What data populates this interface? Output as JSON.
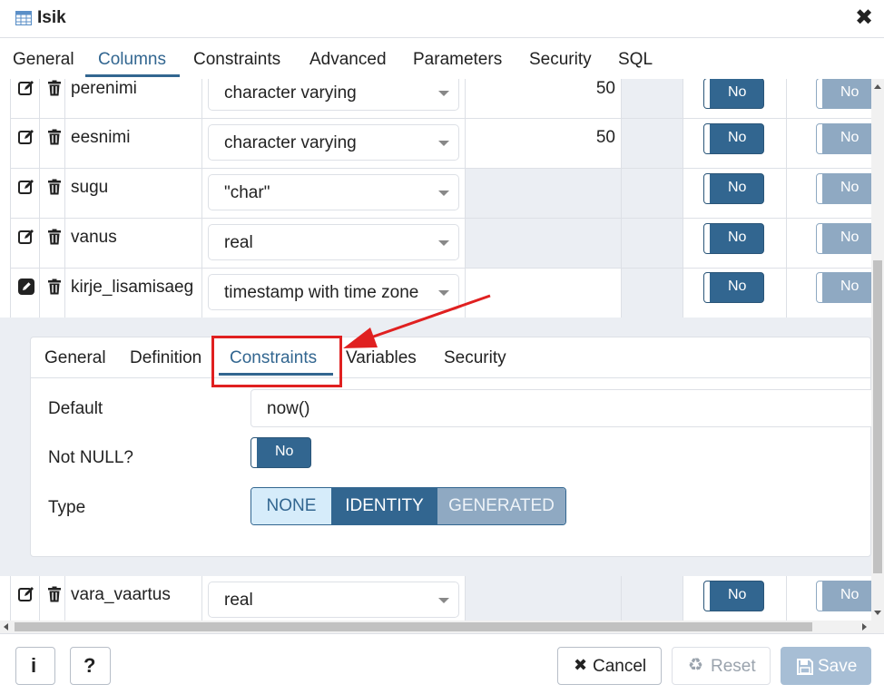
{
  "window": {
    "title": "Isik"
  },
  "tabs": [
    {
      "label": "General"
    },
    {
      "label": "Columns"
    },
    {
      "label": "Constraints"
    },
    {
      "label": "Advanced"
    },
    {
      "label": "Parameters"
    },
    {
      "label": "Security"
    },
    {
      "label": "SQL"
    }
  ],
  "columns": [
    {
      "name": "perenimi",
      "type": "character varying",
      "length": "50",
      "not_null": "No",
      "primary_key": "No"
    },
    {
      "name": "eesnimi",
      "type": "character varying",
      "length": "50",
      "not_null": "No",
      "primary_key": "No"
    },
    {
      "name": "sugu",
      "type": "\"char\"",
      "length": "",
      "not_null": "No",
      "primary_key": "No"
    },
    {
      "name": "vanus",
      "type": "real",
      "length": "",
      "not_null": "No",
      "primary_key": "No"
    },
    {
      "name": "kirje_lisamisaeg",
      "type": "timestamp with time zone",
      "length": "",
      "not_null": "No",
      "primary_key": "No"
    },
    {
      "name": "vara_vaartus",
      "type": "real",
      "length": "",
      "not_null": "No",
      "primary_key": "No"
    }
  ],
  "subpanel": {
    "tabs": [
      {
        "label": "General"
      },
      {
        "label": "Definition"
      },
      {
        "label": "Constraints"
      },
      {
        "label": "Variables"
      },
      {
        "label": "Security"
      }
    ],
    "default_label": "Default",
    "default_value": "now()",
    "not_null_label": "Not NULL?",
    "not_null_value": "No",
    "type_label": "Type",
    "type_options": [
      "NONE",
      "IDENTITY",
      "GENERATED"
    ]
  },
  "footer": {
    "info_label": "i",
    "help_label": "?",
    "cancel_label": "Cancel",
    "reset_label": "Reset",
    "save_label": "Save"
  },
  "colors": {
    "accent": "#326690",
    "annotation": "#e02020"
  }
}
